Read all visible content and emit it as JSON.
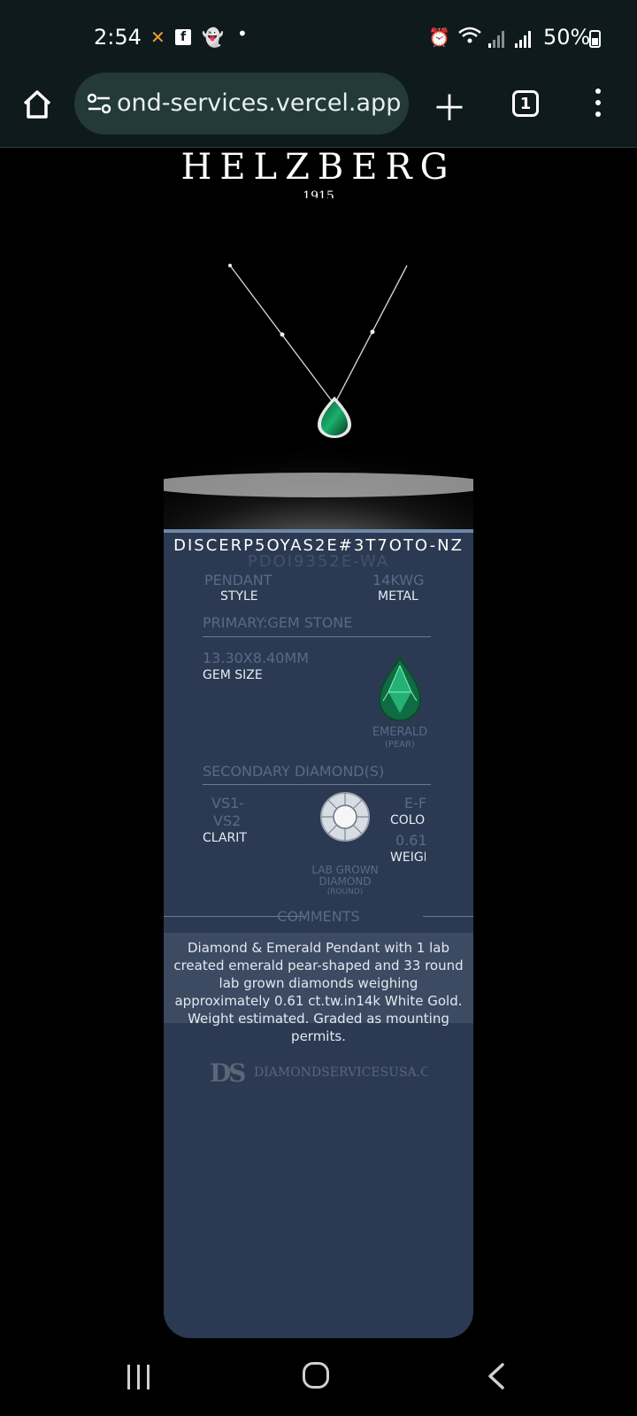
{
  "status_bar": {
    "time": "2:54",
    "battery": "50%"
  },
  "browser": {
    "url": "ond-services.vercel.app",
    "tab_count": "1"
  },
  "brand": {
    "name": "HELZBERG",
    "sub": "1915"
  },
  "product": {
    "code": "DISCERP5OYAS2E#3T7OTO-NZ",
    "code_ghost": "PDOI9352E-WA",
    "style_value": "PENDANT",
    "style_label": "STYLE",
    "metal_value": "14KWG",
    "metal_label": "METAL",
    "primary_title": "PRIMARY:GEM STONE",
    "gem_size_value": "13.30X8.40MM",
    "gem_size_label": "GEM SIZE",
    "gem_name": "EMERALD",
    "gem_shape": "(PEAR)",
    "secondary_title": "SECONDARY DIAMOND(S)",
    "clarity_value_1": "VS1-",
    "clarity_value_2": "VS2",
    "clarity_label": "CLARIT",
    "color_value": "E-F",
    "color_label": "COLOF",
    "weight_value": "0.61",
    "weight_label": "WEIGH",
    "diamond_name_1": "LAB GROWN",
    "diamond_name_2": "DIAMOND",
    "diamond_shape": "(ROUND)",
    "comments_title": "COMMENTS",
    "comments": "Diamond & Emerald Pendant with 1 lab created emerald pear-shaped and 33 round lab grown diamonds weighing approximately 0.61 ct.tw.in14k White Gold. Weight estimated. Graded as mounting permits.",
    "footer_logo": "DS",
    "footer_site": "DIAMONDSERVICESUSA.COM"
  },
  "colors": {
    "card": "#2b3a52",
    "emerald": "#1aa36a",
    "chrome": "#0e1a1c"
  }
}
